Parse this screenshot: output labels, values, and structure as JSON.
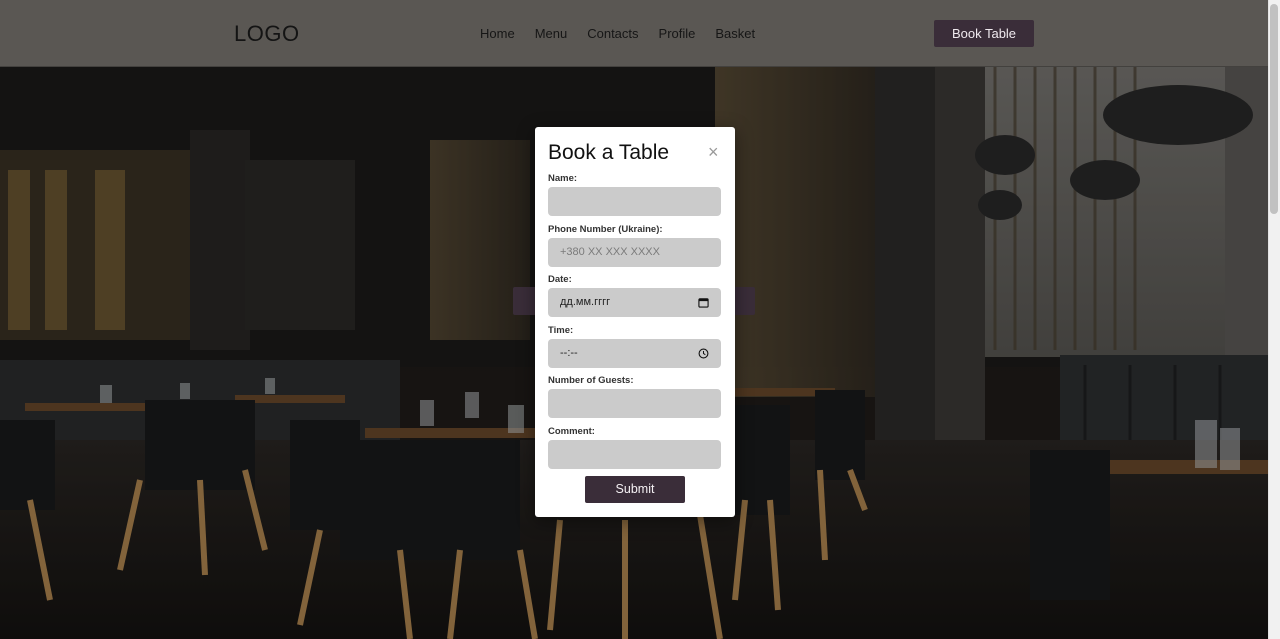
{
  "header": {
    "logo": "LOGO",
    "nav": [
      {
        "label": "Home"
      },
      {
        "label": "Menu"
      },
      {
        "label": "Contacts"
      },
      {
        "label": "Profile"
      },
      {
        "label": "Basket"
      }
    ],
    "book_button": "Book Table"
  },
  "modal": {
    "title": "Book a Table",
    "close_symbol": "×",
    "fields": {
      "name": {
        "label": "Name:",
        "value": ""
      },
      "phone": {
        "label": "Phone Number (Ukraine):",
        "placeholder": "+380 XX XXX XXXX"
      },
      "date": {
        "label": "Date:",
        "placeholder": "дд.мм.гггг"
      },
      "time": {
        "label": "Time:",
        "placeholder": "--:--"
      },
      "guests": {
        "label": "Number of Guests:",
        "value": ""
      },
      "comment": {
        "label": "Comment:",
        "value": ""
      }
    },
    "submit_label": "Submit"
  },
  "colors": {
    "accent": "#3a2d39",
    "input_bg": "#cbcbcb",
    "header_bg": "#5f5c59"
  },
  "icons": {
    "close": "close-icon",
    "date": "calendar-icon",
    "time": "clock-icon"
  }
}
